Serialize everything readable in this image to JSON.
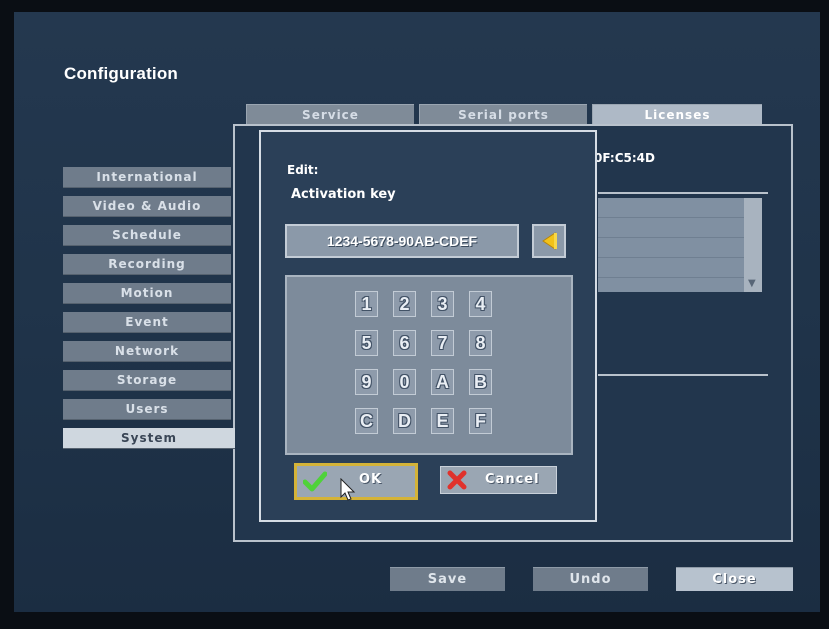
{
  "page": {
    "title": "Configuration"
  },
  "tabs": [
    {
      "label": "Service",
      "active": false
    },
    {
      "label": "Serial ports",
      "active": false
    },
    {
      "label": "Licenses",
      "active": true
    }
  ],
  "menu": [
    {
      "label": "International"
    },
    {
      "label": "Video & Audio"
    },
    {
      "label": "Schedule"
    },
    {
      "label": "Recording"
    },
    {
      "label": "Motion"
    },
    {
      "label": "Event"
    },
    {
      "label": "Network"
    },
    {
      "label": "Storage"
    },
    {
      "label": "Users"
    },
    {
      "label": "System",
      "active": true
    }
  ],
  "background": {
    "mac_fragment": "0F:C5:4D"
  },
  "dialog": {
    "edit_label": "Edit:",
    "field_label": "Activation key",
    "key_value": "1234-5678-90AB-CDEF",
    "keys": [
      "1",
      "2",
      "3",
      "4",
      "5",
      "6",
      "7",
      "8",
      "9",
      "0",
      "A",
      "B",
      "C",
      "D",
      "E",
      "F"
    ],
    "ok_label": "OK",
    "cancel_label": "Cancel"
  },
  "footer": {
    "save_label": "Save",
    "undo_label": "Undo",
    "close_label": "Close"
  },
  "colors": {
    "accent_focus": "#d4b338",
    "ok_check": "#4fd23a",
    "cancel_x": "#e0322c",
    "backspace_arrow": "#f2c21a"
  },
  "icons": {
    "backspace": "backspace-arrow-icon",
    "ok": "checkmark-icon",
    "cancel": "x-icon",
    "pointer": "mouse-pointer-icon"
  }
}
